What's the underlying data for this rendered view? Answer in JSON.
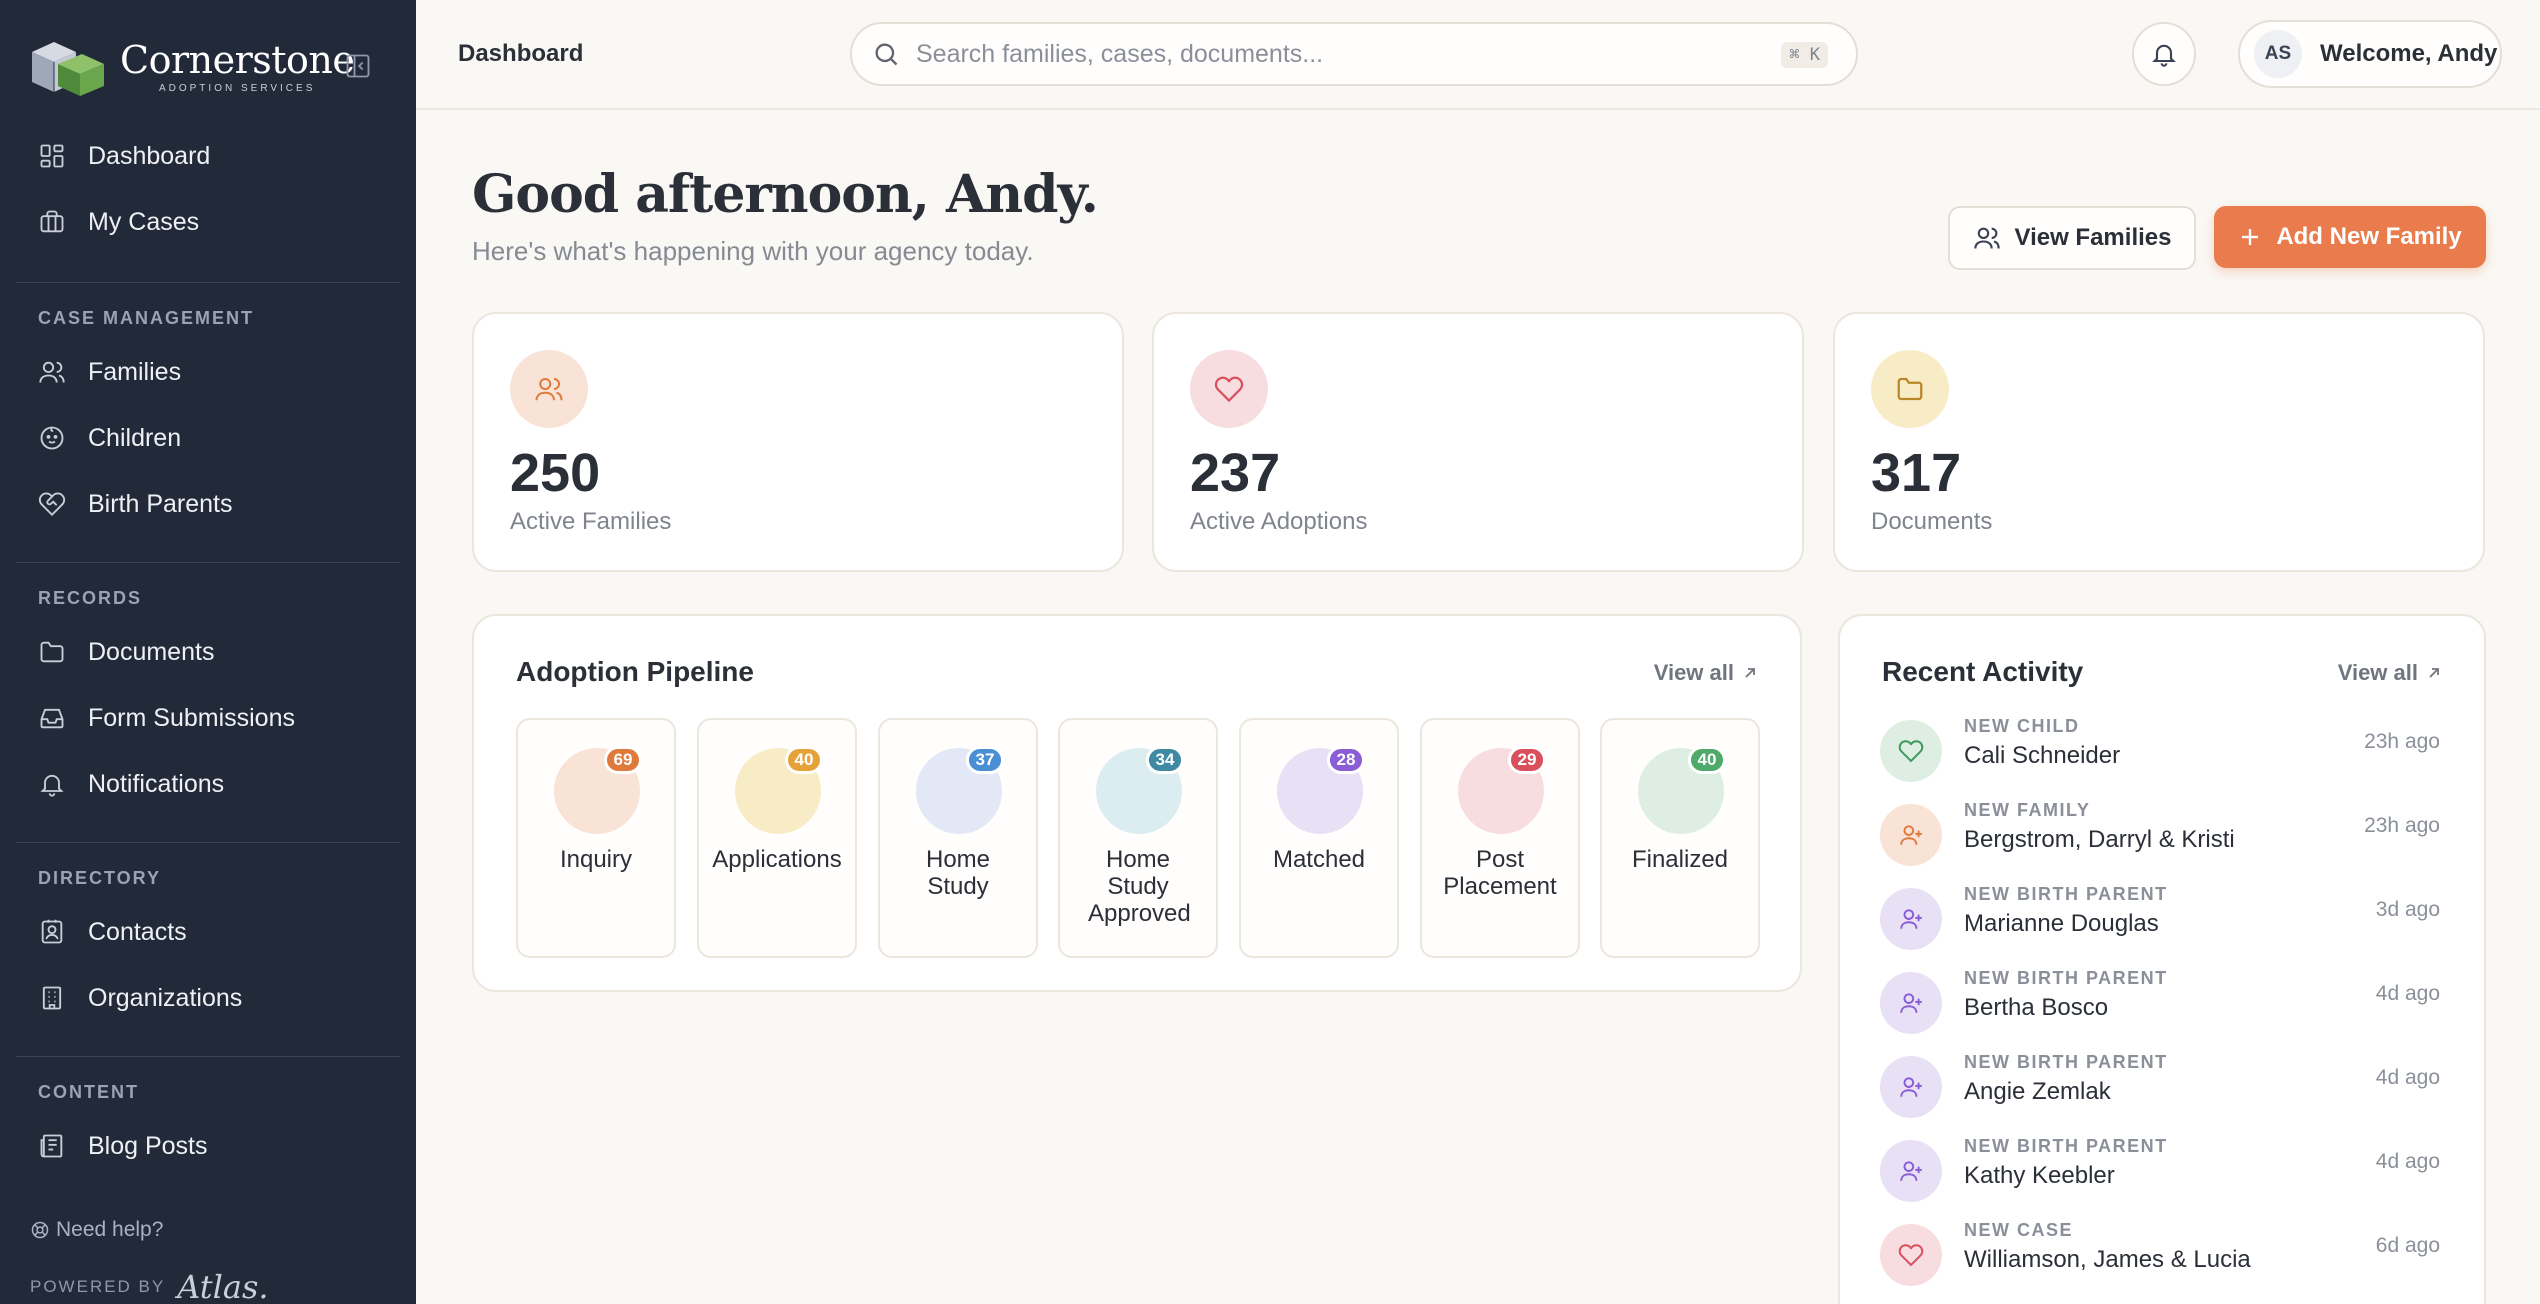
{
  "brand": {
    "name": "Cornerstone",
    "subtitle": "ADOPTION SERVICES"
  },
  "sidebar": {
    "top_items": [
      {
        "label": "Dashboard",
        "icon": "dashboard-icon"
      },
      {
        "label": "My Cases",
        "icon": "briefcase-icon"
      }
    ],
    "sections": [
      {
        "title": "CASE MANAGEMENT",
        "items": [
          {
            "label": "Families",
            "icon": "users-icon"
          },
          {
            "label": "Children",
            "icon": "baby-icon"
          },
          {
            "label": "Birth Parents",
            "icon": "heart-handshake-icon"
          }
        ]
      },
      {
        "title": "RECORDS",
        "items": [
          {
            "label": "Documents",
            "icon": "folder-icon"
          },
          {
            "label": "Form Submissions",
            "icon": "inbox-icon"
          },
          {
            "label": "Notifications",
            "icon": "bell-icon"
          }
        ]
      },
      {
        "title": "DIRECTORY",
        "items": [
          {
            "label": "Contacts",
            "icon": "contact-icon"
          },
          {
            "label": "Organizations",
            "icon": "building-icon"
          }
        ]
      },
      {
        "title": "CONTENT",
        "items": [
          {
            "label": "Blog Posts",
            "icon": "newspaper-icon"
          }
        ]
      }
    ],
    "help": "Need help?",
    "powered_by": "POWERED BY",
    "powered_logo": "Atlas."
  },
  "topbar": {
    "breadcrumb": "Dashboard",
    "search_placeholder": "Search families, cases, documents...",
    "search_shortcut": "⌘ K",
    "user_initials": "AS",
    "welcome": "Welcome, Andy"
  },
  "greeting": {
    "title": "Good afternoon, Andy.",
    "subtitle": "Here's what's happening with your agency today."
  },
  "actions": {
    "view_families": "View Families",
    "add_family": "Add New Family"
  },
  "stats": [
    {
      "value": "250",
      "label": "Active Families",
      "icon": "users-icon"
    },
    {
      "value": "237",
      "label": "Active Adoptions",
      "icon": "heart-icon"
    },
    {
      "value": "317",
      "label": "Documents",
      "icon": "folder-icon"
    }
  ],
  "pipeline": {
    "title": "Adoption Pipeline",
    "view_all": "View all",
    "stages": [
      {
        "label": "Inquiry",
        "count": "69",
        "circle": "#f9e3d6",
        "badge": "#e07a3c"
      },
      {
        "label": "Applications",
        "count": "40",
        "circle": "#f8ecc6",
        "badge": "#e6a23a"
      },
      {
        "label": "Home Study",
        "count": "37",
        "circle": "#e2e8f5",
        "badge": "#4a8fd4"
      },
      {
        "label": "Home Study Approved",
        "count": "34",
        "circle": "#dcedf2",
        "badge": "#3f8aa3"
      },
      {
        "label": "Matched",
        "count": "28",
        "circle": "#e8e0f5",
        "badge": "#8a5cd6"
      },
      {
        "label": "Post Placement",
        "count": "29",
        "circle": "#f8dde0",
        "badge": "#d9505c"
      },
      {
        "label": "Finalized",
        "count": "40",
        "circle": "#dfeee3",
        "badge": "#4faa6a"
      }
    ]
  },
  "activity": {
    "title": "Recent Activity",
    "view_all": "View all",
    "items": [
      {
        "type": "NEW CHILD",
        "name": "Cali Schneider",
        "time": "23h ago",
        "icon": "heart-icon",
        "bg": "#dfeee3",
        "fg": "#3e9a5c"
      },
      {
        "type": "NEW FAMILY",
        "name": "Bergstrom, Darryl & Kristi",
        "time": "23h ago",
        "icon": "user-plus-icon",
        "bg": "#f9e3d6",
        "fg": "#e07a3c"
      },
      {
        "type": "NEW BIRTH PARENT",
        "name": "Marianne Douglas",
        "time": "3d ago",
        "icon": "user-plus-icon",
        "bg": "#e8e0f5",
        "fg": "#8a5cd6"
      },
      {
        "type": "NEW BIRTH PARENT",
        "name": "Bertha Bosco",
        "time": "4d ago",
        "icon": "user-plus-icon",
        "bg": "#e8e0f5",
        "fg": "#8a5cd6"
      },
      {
        "type": "NEW BIRTH PARENT",
        "name": "Angie Zemlak",
        "time": "4d ago",
        "icon": "user-plus-icon",
        "bg": "#e8e0f5",
        "fg": "#8a5cd6"
      },
      {
        "type": "NEW BIRTH PARENT",
        "name": "Kathy Keebler",
        "time": "4d ago",
        "icon": "user-plus-icon",
        "bg": "#e8e0f5",
        "fg": "#8a5cd6"
      },
      {
        "type": "NEW CASE",
        "name": "Williamson, James & Lucia",
        "time": "6d ago",
        "icon": "heart-icon",
        "bg": "#f8dde0",
        "fg": "#d9505c"
      }
    ]
  },
  "colors": {
    "sidebar": "#222a3a",
    "accent": "#e97b4c",
    "background": "#faf8f4"
  }
}
